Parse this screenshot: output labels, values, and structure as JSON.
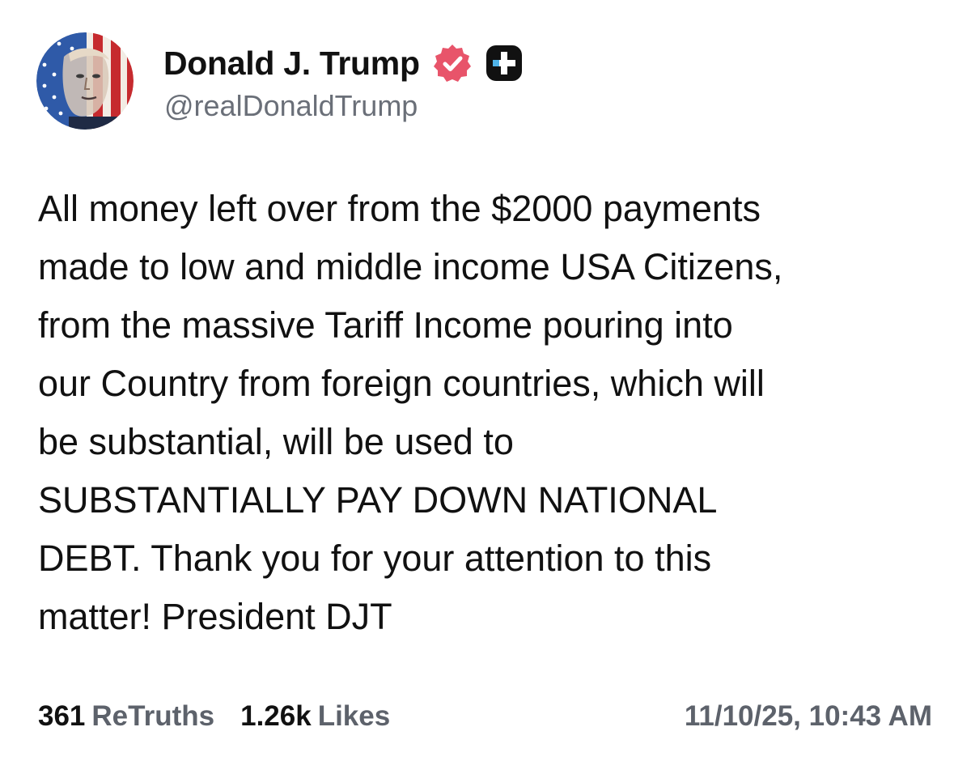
{
  "author": {
    "display_name": "Donald J. Trump",
    "handle": "@realDonaldTrump",
    "verified_icon": "verified-badge-icon",
    "verified_color": "#e8546a",
    "plus_icon": "plus-badge-icon",
    "plus_color": "#111111",
    "avatar_icon": "flag-portrait-avatar"
  },
  "post": {
    "lines": [
      "All money left over from the $2000 payments",
      "made to low and middle income USA Citizens,",
      "from the massive Tariff Income pouring into",
      "our Country from foreign countries, which will",
      "be substantial, will be used to",
      "SUBSTANTIALLY PAY DOWN NATIONAL",
      "DEBT. Thank you for your attention to this",
      "matter! President DJT"
    ]
  },
  "stats": {
    "retruths_count": "361",
    "retruths_label": "ReTruths",
    "likes_count": "1.26k",
    "likes_label": "Likes"
  },
  "timestamp": "11/10/25, 10:43 AM",
  "colors": {
    "text": "#111111",
    "secondary_text": "#5d626b",
    "background": "#ffffff"
  }
}
